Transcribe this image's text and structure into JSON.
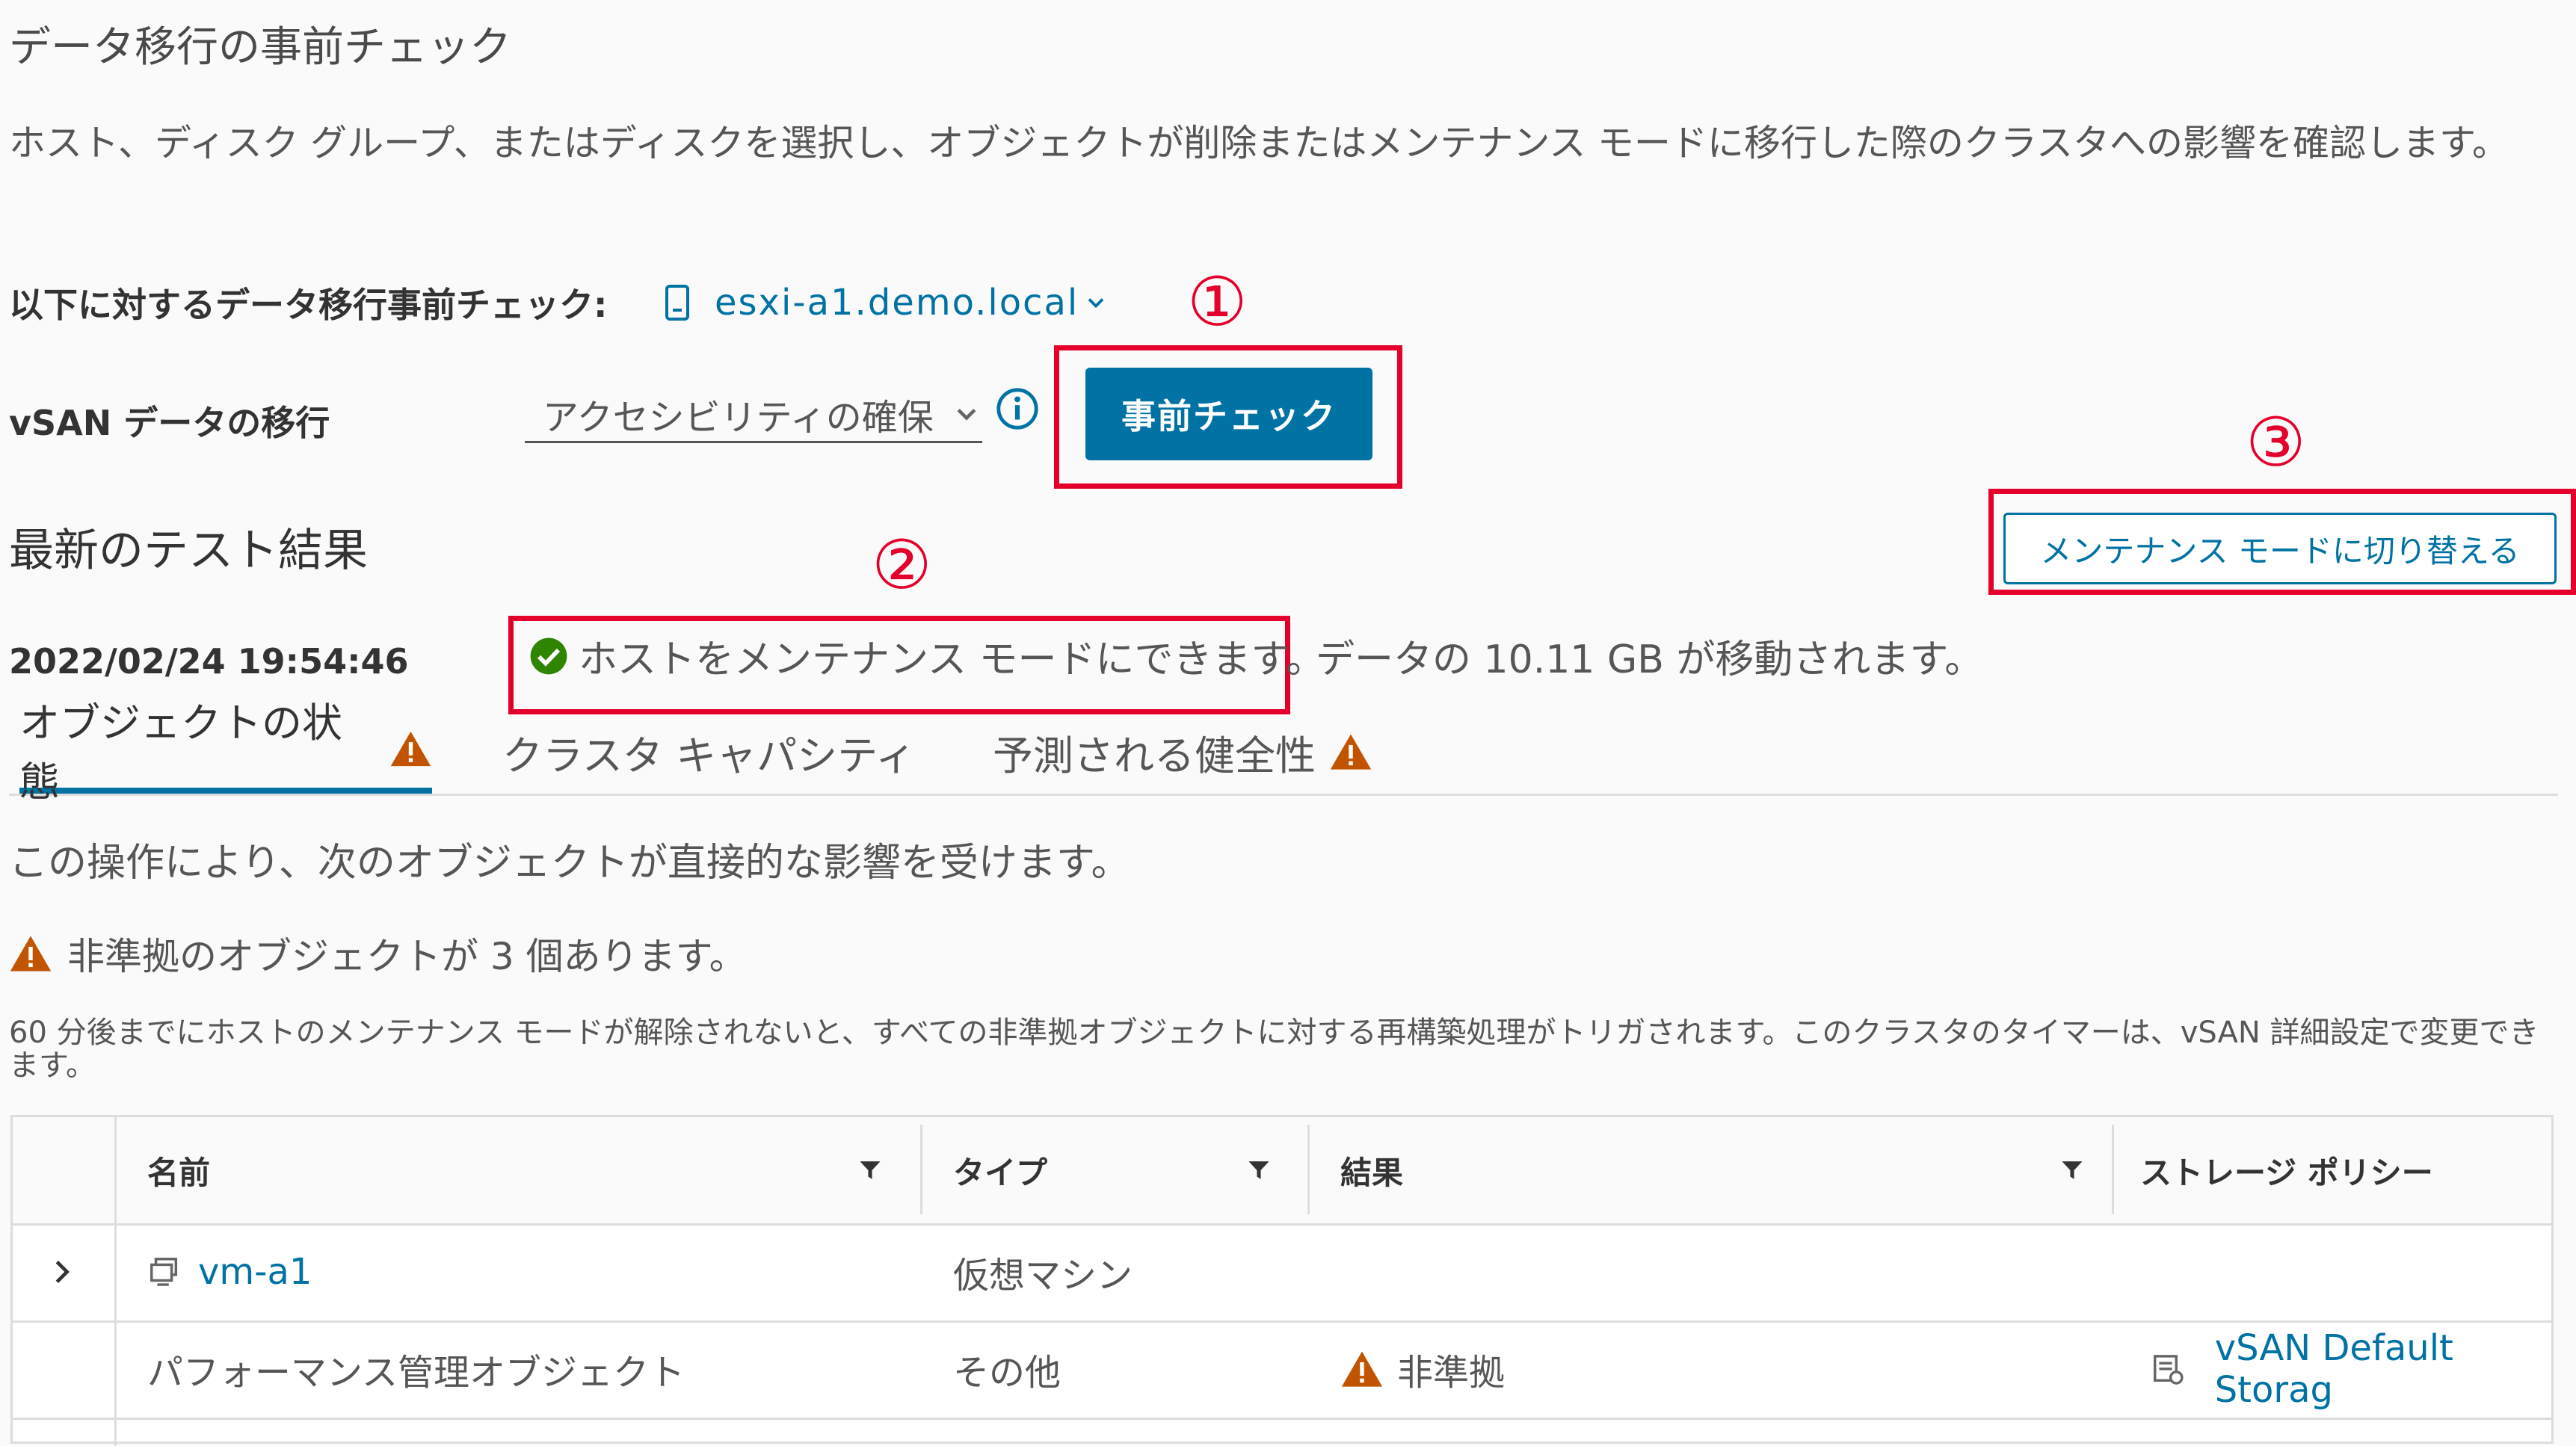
{
  "page": {
    "title": "データ移行の事前チェック",
    "description": "ホスト、ディスク グループ、またはディスクを選択し、オブジェクトが削除またはメンテナンス モードに移行した際のクラスタへの影響を確認します。"
  },
  "target": {
    "label": "以下に対するデータ移行事前チェック:",
    "host_name": "esxi-a1.demo.local"
  },
  "migration": {
    "label": "vSAN データの移行",
    "selected": "アクセシビリティの確保",
    "precheck_label": "事前チェック"
  },
  "callouts": [
    "①",
    "②",
    "③"
  ],
  "latest": {
    "title": "最新のテスト結果",
    "maintenance_button": "メンテナンス モードに切り替える",
    "timestamp": "2022/02/24 19:54:46",
    "result_ok": "ホストをメンテナンス モードにできます。",
    "result_extra": "データの 10.11 GB が移動されます。"
  },
  "tabs": [
    {
      "label": "オブジェクトの状態",
      "warning": true
    },
    {
      "label": "クラスタ キャパシティ",
      "warning": false
    },
    {
      "label": "予測される健全性",
      "warning": true
    }
  ],
  "impact_text": "この操作により、次のオブジェクトが直接的な影響を受けます。",
  "noncompliant_text": "非準拠のオブジェクトが 3 個あります。",
  "rebuild_note": "60 分後までにホストのメンテナンス モードが解除されないと、すべての非準拠オブジェクトに対する再構築処理がトリガされます。このクラスタのタイマーは、vSAN 詳細設定で変更できます。",
  "grid": {
    "columns": [
      "名前",
      "タイプ",
      "結果",
      "ストレージ ポリシー"
    ],
    "rows": [
      {
        "name": "vm-a1",
        "type": "仮想マシン",
        "result": "",
        "policy": ""
      },
      {
        "name": "パフォーマンス管理オブジェクト",
        "type": "その他",
        "result": "非準拠",
        "policy": "vSAN Default Storag"
      }
    ]
  },
  "colors": {
    "accent": "#0072a3",
    "callout": "#e4002b",
    "warning": "#c25400",
    "ok": "#2f8400"
  }
}
